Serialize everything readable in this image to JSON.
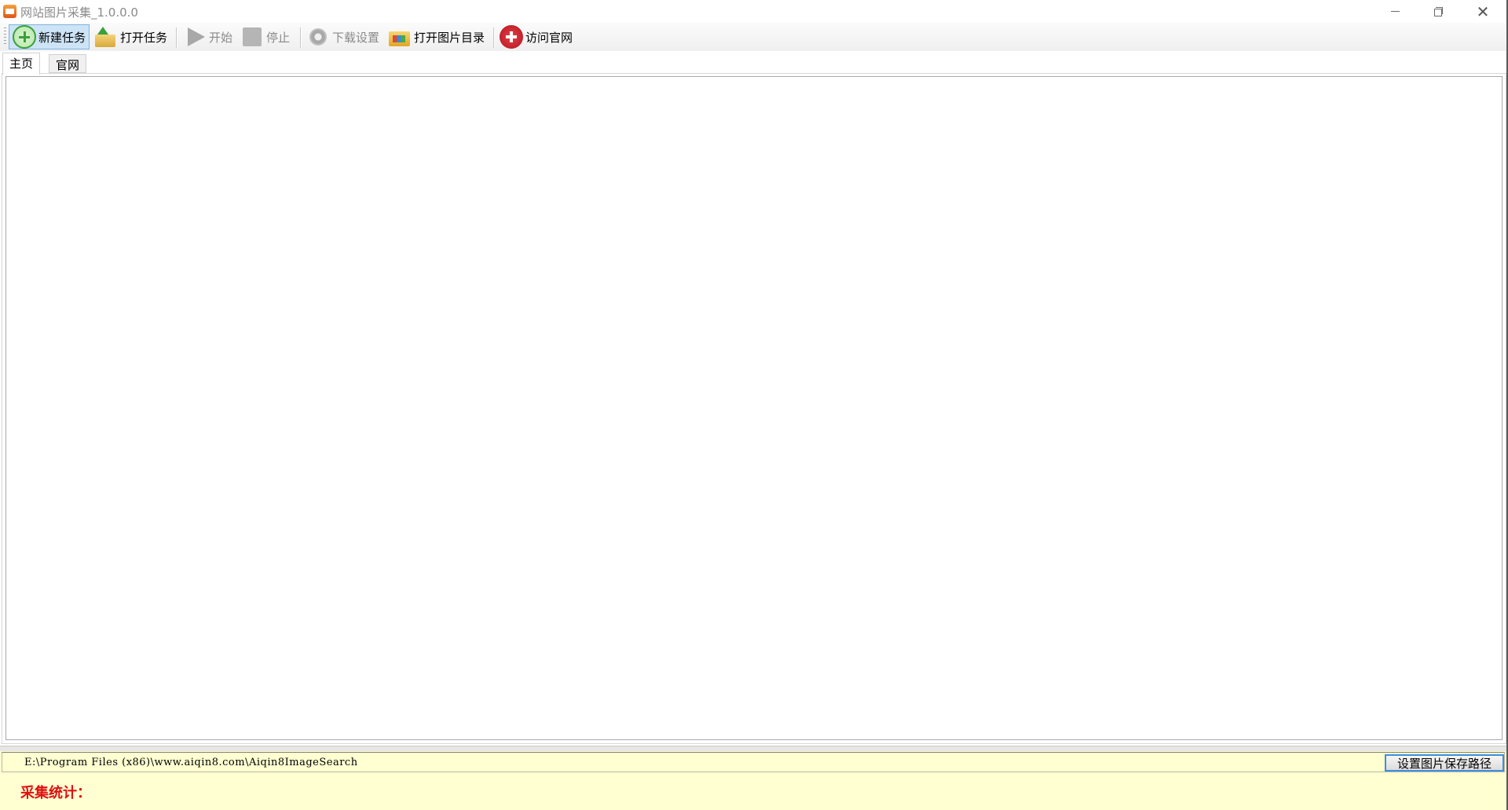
{
  "window": {
    "title": "网站图片采集_1.0.0.0"
  },
  "toolbar": {
    "items": [
      {
        "label": "新建任务",
        "icon": "plus-circle-icon",
        "state": "active"
      },
      {
        "label": "打开任务",
        "icon": "open-folder-icon",
        "state": "enabled"
      },
      {
        "label": "开始",
        "icon": "play-icon",
        "state": "disabled"
      },
      {
        "label": "停止",
        "icon": "stop-icon",
        "state": "disabled"
      },
      {
        "label": "下载设置",
        "icon": "gear-icon",
        "state": "disabled"
      },
      {
        "label": "打开图片目录",
        "icon": "image-folder-icon",
        "state": "enabled"
      },
      {
        "label": "访问官网",
        "icon": "website-icon",
        "state": "enabled"
      }
    ]
  },
  "tabs": [
    {
      "label": "主页",
      "selected": true
    },
    {
      "label": "官网",
      "selected": false
    }
  ],
  "footer": {
    "save_path": "E:\\Program Files (x86)\\www.aiqin8.com\\Aiqin8ImageSearch",
    "set_path_button": "设置图片保存路径",
    "stats_label": "采集统计："
  },
  "colors": {
    "footer_background": "#ffffd2",
    "stats_text": "#e01010",
    "active_button": "#cde4f7"
  }
}
